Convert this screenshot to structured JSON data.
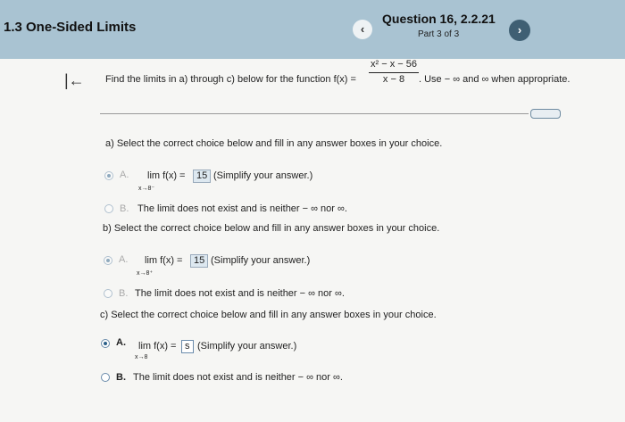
{
  "header": {
    "section_title": "1.3 One-Sided Limits",
    "question_title": "Question 16, 2.2.21",
    "part": "Part 3 of 3",
    "prev_icon": "chevron-left-icon",
    "next_icon": "chevron-right-icon"
  },
  "instruction": {
    "prefix": "Find the limits in a) through c) below for the function f(x) =",
    "numerator": "x² − x − 56",
    "denominator": "x − 8",
    "suffix": ". Use − ∞ and ∞ when appropriate."
  },
  "parts": [
    {
      "prompt": "a) Select the correct choice below and fill in any answer boxes in your choice.",
      "option_a_letter": "A.",
      "option_a_lim": "lim f(x) =",
      "option_a_sub": "x→8⁻",
      "option_a_value": "15",
      "option_a_hint": "(Simplify your answer.)",
      "option_b_letter": "B.",
      "option_b_text": "The limit does not exist and is neither − ∞ nor ∞."
    },
    {
      "prompt": "b) Select the correct choice below and fill in any answer boxes in your choice.",
      "option_a_letter": "A.",
      "option_a_lim": "lim f(x) =",
      "option_a_sub": "x→8⁺",
      "option_a_value": "15",
      "option_a_hint": "(Simplify your answer.)",
      "option_b_letter": "B.",
      "option_b_text": "The limit does not exist and is neither − ∞ nor ∞."
    },
    {
      "prompt": "c) Select the correct choice below and fill in any answer boxes in your choice.",
      "option_a_letter": "A.",
      "option_a_lim": "lim f(x) =",
      "option_a_sub": "x→8",
      "option_a_value": "s",
      "option_a_hint": "(Simplify your answer.)",
      "option_b_letter": "B.",
      "option_b_text": "The limit does not exist and is neither − ∞ nor ∞."
    }
  ]
}
